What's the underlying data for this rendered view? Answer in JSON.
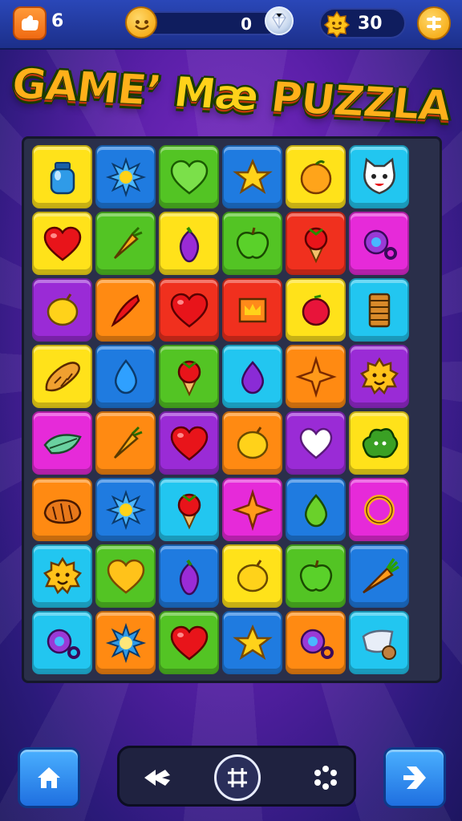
{
  "title": {
    "part1": "GAME’",
    "part2": " Mæ ",
    "part3": "PUZZLA"
  },
  "topbar": {
    "lives": "6",
    "progress_value": "0",
    "progress_fraction": 0.0,
    "stars": "30"
  },
  "icons": {
    "lives": "thumb-icon",
    "coin": "smiley-coin-icon",
    "gem": "diamond-gem-icon",
    "star": "gold-badge-icon",
    "menu": "grid-menu-icon",
    "home": "home-icon",
    "next": "arrow-right-icon",
    "back": "rewind-icon",
    "center": "target-crosshair-icon",
    "shuffle": "shuffle-ring-icon"
  },
  "colors": {
    "yellow": "#ffe21a",
    "blue": "#1f7be0",
    "green": "#53c424",
    "orange": "#ff8a12",
    "cyan": "#22c6f0",
    "red": "#f0301e",
    "purple": "#9a2bd6",
    "magenta": "#e62ad9"
  },
  "board": {
    "rows": [
      [
        {
          "c": "yellow",
          "i": "jar"
        },
        {
          "c": "blue",
          "i": "sun"
        },
        {
          "c": "green",
          "i": "heart-green"
        },
        {
          "c": "blue",
          "i": "star"
        },
        {
          "c": "yellow",
          "i": "orange"
        },
        {
          "c": "cyan",
          "i": "cat"
        }
      ],
      [
        {
          "c": "yellow",
          "i": "heart-red"
        },
        {
          "c": "green",
          "i": "carrot"
        },
        {
          "c": "yellow",
          "i": "eggplant"
        },
        {
          "c": "green",
          "i": "apple-green"
        },
        {
          "c": "red",
          "i": "strawberry"
        },
        {
          "c": "magenta",
          "i": "ring-purple"
        }
      ],
      [
        {
          "c": "purple",
          "i": "lemon"
        },
        {
          "c": "orange",
          "i": "pepper"
        },
        {
          "c": "red",
          "i": "heart-red"
        },
        {
          "c": "red",
          "i": "crown-box"
        },
        {
          "c": "yellow",
          "i": "berry"
        },
        {
          "c": "cyan",
          "i": "barrel"
        }
      ],
      [
        {
          "c": "yellow",
          "i": "bread"
        },
        {
          "c": "blue",
          "i": "drop"
        },
        {
          "c": "green",
          "i": "strawberry"
        },
        {
          "c": "cyan",
          "i": "drop-purple"
        },
        {
          "c": "orange",
          "i": "star-orange"
        },
        {
          "c": "purple",
          "i": "sun-face"
        }
      ],
      [
        {
          "c": "magenta",
          "i": "leaf"
        },
        {
          "c": "orange",
          "i": "carrot"
        },
        {
          "c": "purple",
          "i": "heart-red"
        },
        {
          "c": "orange",
          "i": "lemon"
        },
        {
          "c": "purple",
          "i": "heart-white"
        },
        {
          "c": "yellow",
          "i": "bush"
        }
      ],
      [
        {
          "c": "orange",
          "i": "loaf"
        },
        {
          "c": "blue",
          "i": "sun"
        },
        {
          "c": "cyan",
          "i": "strawberry"
        },
        {
          "c": "magenta",
          "i": "star-orange"
        },
        {
          "c": "blue",
          "i": "drop-green"
        },
        {
          "c": "magenta",
          "i": "ring-gold"
        }
      ],
      [
        {
          "c": "cyan",
          "i": "sun-face"
        },
        {
          "c": "green",
          "i": "heart-yellow"
        },
        {
          "c": "blue",
          "i": "eggplant"
        },
        {
          "c": "yellow",
          "i": "lemon"
        },
        {
          "c": "green",
          "i": "apple-green"
        },
        {
          "c": "blue",
          "i": "carrot-big"
        }
      ],
      [
        {
          "c": "cyan",
          "i": "ring-purple"
        },
        {
          "c": "orange",
          "i": "sun-blue"
        },
        {
          "c": "green",
          "i": "heart-red"
        },
        {
          "c": "blue",
          "i": "star"
        },
        {
          "c": "orange",
          "i": "ring-purple"
        },
        {
          "c": "cyan",
          "i": "bag"
        }
      ]
    ]
  }
}
